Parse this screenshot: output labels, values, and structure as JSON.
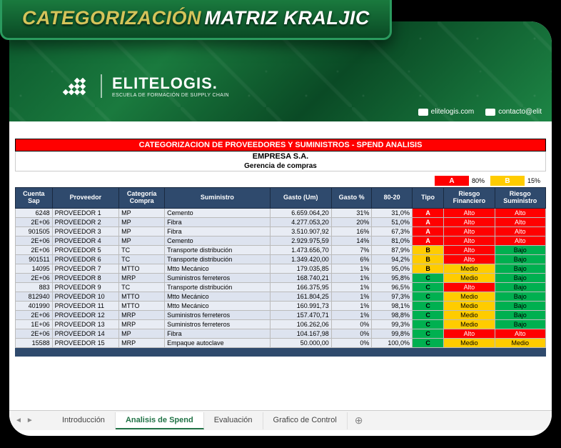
{
  "title": {
    "part1": "CATEGORIZACIÓN",
    "part2": "MATRIZ KRALJIC"
  },
  "logo": {
    "brand": "ELITELOGIS.",
    "sub": "ESCUELA DE FORMACIÓN DE SUPPLY CHAIN"
  },
  "contact": {
    "site": "elitelogis.com",
    "email": "contacto@elit"
  },
  "sheet": {
    "red_title": "CATEGORIZACION DE PROVEEDORES Y SUMINISTROS - SPEND ANALISIS",
    "company": "EMPRESA S.A.",
    "dept": "Gerencia de compras"
  },
  "legend": {
    "a_label": "A",
    "a_pct": "80%",
    "b_label": "B",
    "b_pct": "15%"
  },
  "headers": [
    "Cuenta Sap",
    "Proveedor",
    "Categoría Compra",
    "Suministro",
    "Gasto (Um)",
    "Gasto %",
    "80-20",
    "Tipo",
    "Riesgo Financiero",
    "Riesgo Suministro"
  ],
  "rows": [
    {
      "cuenta": "6248",
      "prov": "PROVEEDOR 1",
      "cat": "MP",
      "sum": "Cemento",
      "gasto": "6.659.064,20",
      "gpct": "31%",
      "p8020": "31,0%",
      "tipo": "A",
      "rf": "Alto",
      "rs": "Alto"
    },
    {
      "cuenta": "2E+06",
      "prov": "PROVEEDOR 2",
      "cat": "MP",
      "sum": "Fibra",
      "gasto": "4.277.053,20",
      "gpct": "20%",
      "p8020": "51,0%",
      "tipo": "A",
      "rf": "Alto",
      "rs": "Alto"
    },
    {
      "cuenta": "901505",
      "prov": "PROVEEDOR 3",
      "cat": "MP",
      "sum": "Fibra",
      "gasto": "3.510.907,92",
      "gpct": "16%",
      "p8020": "67,3%",
      "tipo": "A",
      "rf": "Alto",
      "rs": "Alto"
    },
    {
      "cuenta": "2E+06",
      "prov": "PROVEEDOR 4",
      "cat": "MP",
      "sum": "Cemento",
      "gasto": "2.929.975,59",
      "gpct": "14%",
      "p8020": "81,0%",
      "tipo": "A",
      "rf": "Alto",
      "rs": "Alto"
    },
    {
      "cuenta": "2E+06",
      "prov": "PROVEEDOR 5",
      "cat": "TC",
      "sum": "Transporte distribución",
      "gasto": "1.473.656,70",
      "gpct": "7%",
      "p8020": "87,9%",
      "tipo": "B",
      "rf": "Alto",
      "rs": "Bajo"
    },
    {
      "cuenta": "901511",
      "prov": "PROVEEDOR 6",
      "cat": "TC",
      "sum": "Transporte distribución",
      "gasto": "1.349.420,00",
      "gpct": "6%",
      "p8020": "94,2%",
      "tipo": "B",
      "rf": "Alto",
      "rs": "Bajo"
    },
    {
      "cuenta": "14095",
      "prov": "PROVEEDOR 7",
      "cat": "MTTO",
      "sum": "Mtto Mecánico",
      "gasto": "179.035,85",
      "gpct": "1%",
      "p8020": "95,0%",
      "tipo": "B",
      "rf": "Medio",
      "rs": "Bajo"
    },
    {
      "cuenta": "2E+06",
      "prov": "PROVEEDOR 8",
      "cat": "MRP",
      "sum": "Suministros ferreteros",
      "gasto": "168.740,21",
      "gpct": "1%",
      "p8020": "95,8%",
      "tipo": "C",
      "rf": "Medio",
      "rs": "Bajo"
    },
    {
      "cuenta": "883",
      "prov": "PROVEEDOR 9",
      "cat": "TC",
      "sum": "Transporte distribución",
      "gasto": "166.375,95",
      "gpct": "1%",
      "p8020": "96,5%",
      "tipo": "C",
      "rf": "Alto",
      "rs": "Bajo"
    },
    {
      "cuenta": "812940",
      "prov": "PROVEEDOR 10",
      "cat": "MTTO",
      "sum": "Mtto Mecánico",
      "gasto": "161.804,25",
      "gpct": "1%",
      "p8020": "97,3%",
      "tipo": "C",
      "rf": "Medio",
      "rs": "Bajo"
    },
    {
      "cuenta": "401990",
      "prov": "PROVEEDOR 11",
      "cat": "MTTO",
      "sum": "Mtto Mecánico",
      "gasto": "160.991,73",
      "gpct": "1%",
      "p8020": "98,1%",
      "tipo": "C",
      "rf": "Medio",
      "rs": "Bajo"
    },
    {
      "cuenta": "2E+06",
      "prov": "PROVEEDOR 12",
      "cat": "MRP",
      "sum": "Suministros ferreteros",
      "gasto": "157.470,71",
      "gpct": "1%",
      "p8020": "98,8%",
      "tipo": "C",
      "rf": "Medio",
      "rs": "Bajo"
    },
    {
      "cuenta": "1E+06",
      "prov": "PROVEEDOR 13",
      "cat": "MRP",
      "sum": "Suministros ferreteros",
      "gasto": "106.262,06",
      "gpct": "0%",
      "p8020": "99,3%",
      "tipo": "C",
      "rf": "Medio",
      "rs": "Bajo"
    },
    {
      "cuenta": "2E+06",
      "prov": "PROVEEDOR 14",
      "cat": "MP",
      "sum": "Fibra",
      "gasto": "104.167,98",
      "gpct": "0%",
      "p8020": "99,8%",
      "tipo": "C",
      "rf": "Alto",
      "rs": "Alto"
    },
    {
      "cuenta": "15588",
      "prov": "PROVEEDOR 15",
      "cat": "MRP",
      "sum": "Empaque autoclave",
      "gasto": "50.000,00",
      "gpct": "0%",
      "p8020": "100,0%",
      "tipo": "C",
      "rf": "Medio",
      "rs": "Medio"
    }
  ],
  "tabs": [
    "Introducción",
    "Analisis de Spend",
    "Evaluación",
    "Grafico de Control"
  ],
  "active_tab": 1
}
